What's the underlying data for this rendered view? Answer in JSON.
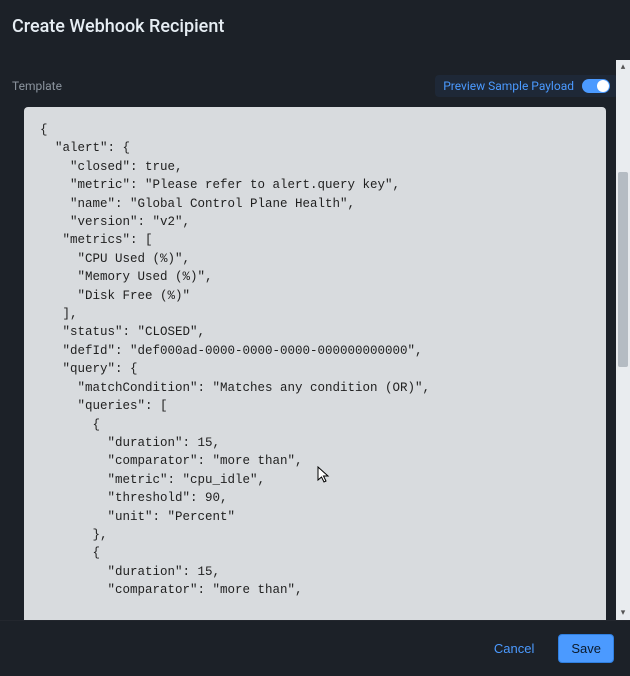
{
  "title": "Create Webhook Recipient",
  "sectionLabel": "Template",
  "preview": {
    "label": "Preview Sample Payload",
    "on": true
  },
  "code": "{\n  \"alert\": {\n    \"closed\": true,\n    \"metric\": \"Please refer to alert.query key\",\n    \"name\": \"Global Control Plane Health\",\n    \"version\": \"v2\",\n   \"metrics\": [\n     \"CPU Used (%)\",\n     \"Memory Used (%)\",\n     \"Disk Free (%)\"\n   ],\n   \"status\": \"CLOSED\",\n   \"defId\": \"def000ad-0000-0000-0000-000000000000\",\n   \"query\": {\n     \"matchCondition\": \"Matches any condition (OR)\",\n     \"queries\": [\n       {\n         \"duration\": 15,\n         \"comparator\": \"more than\",\n         \"metric\": \"cpu_idle\",\n         \"threshold\": 90,\n         \"unit\": \"Percent\"\n       },\n       {\n         \"duration\": 15,\n         \"comparator\": \"more than\",",
  "buttons": {
    "cancel": "Cancel",
    "save": "Save"
  }
}
